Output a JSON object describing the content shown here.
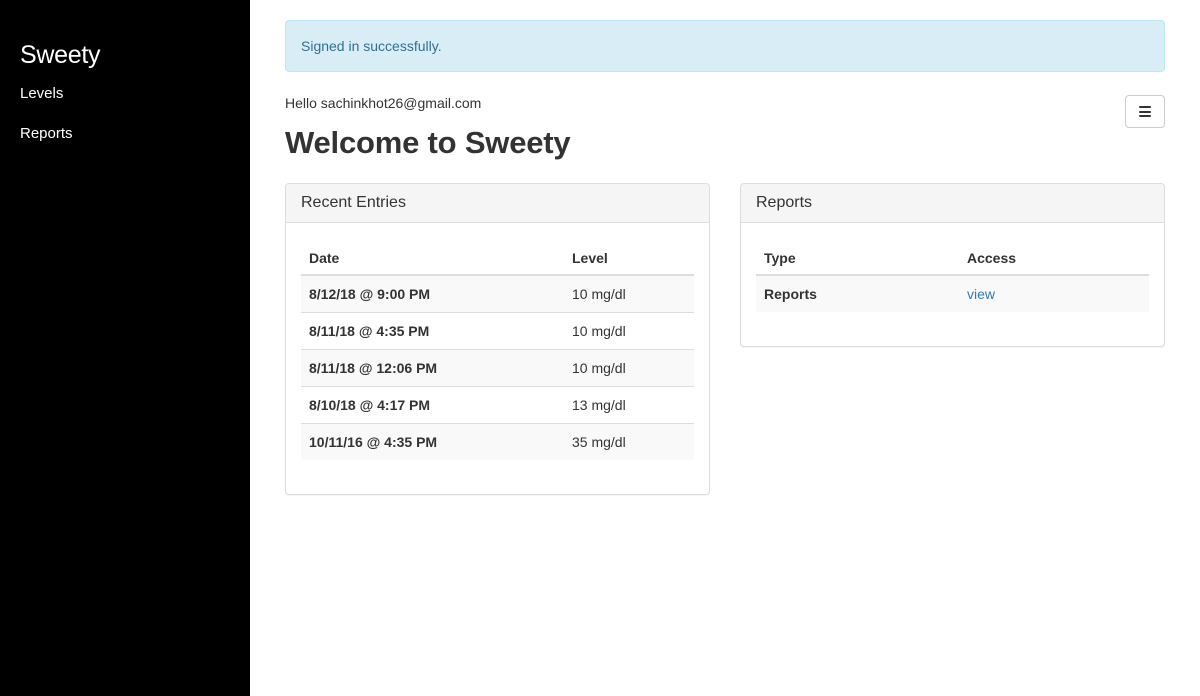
{
  "sidebar": {
    "brand": "Sweety",
    "items": [
      {
        "label": "Levels"
      },
      {
        "label": "Reports"
      }
    ]
  },
  "alert": {
    "text": "Signed in successfully."
  },
  "greeting": "Hello sachinkhot26@gmail.com",
  "menu_button": {
    "icon": "hamburger-icon"
  },
  "page_title": "Welcome to Sweety",
  "recent_entries": {
    "title": "Recent Entries",
    "columns": [
      "Date",
      "Level"
    ],
    "rows": [
      {
        "date": "8/12/18 @ 9:00 PM",
        "level": "10 mg/dl"
      },
      {
        "date": "8/11/18 @ 4:35 PM",
        "level": "10 mg/dl"
      },
      {
        "date": "8/11/18 @ 12:06 PM",
        "level": "10 mg/dl"
      },
      {
        "date": "8/10/18 @ 4:17 PM",
        "level": "13 mg/dl"
      },
      {
        "date": "10/11/16 @ 4:35 PM",
        "level": "35 mg/dl"
      }
    ]
  },
  "reports": {
    "title": "Reports",
    "columns": [
      "Type",
      "Access"
    ],
    "rows": [
      {
        "type": "Reports",
        "access": "view"
      }
    ]
  },
  "colors": {
    "sidebar_bg": "#000000",
    "alert_bg": "#d9edf7",
    "alert_text": "#31708f",
    "link": "#337ab7"
  }
}
